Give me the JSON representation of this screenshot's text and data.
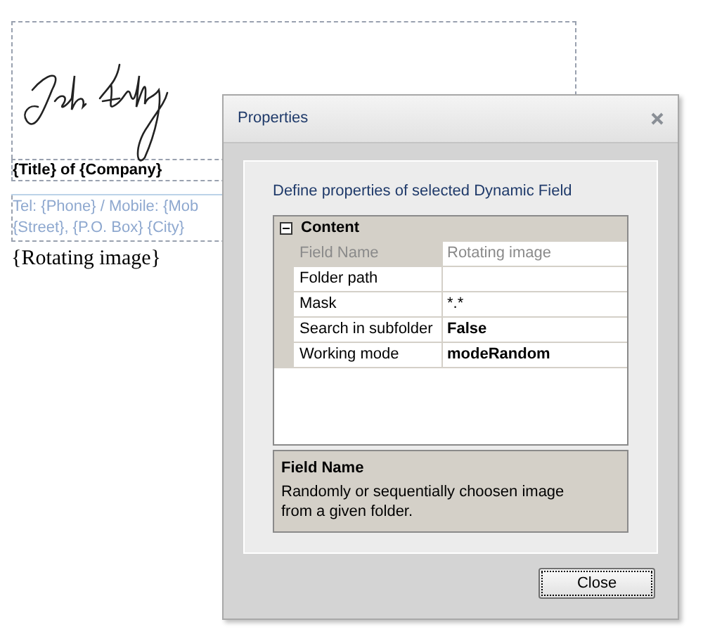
{
  "document": {
    "title_line": "{Title} of {Company}",
    "contact_lines": [
      "Tel: {Phone} / Mobile: {Mob",
      "{Street}, {P.O. Box} {City}"
    ],
    "rotating_image": "{Rotating image}"
  },
  "dialog": {
    "title": "Properties",
    "description": "Define properties of selected Dynamic Field",
    "category": {
      "name": "Content",
      "expanded": true
    },
    "properties": [
      {
        "name": "Field Name",
        "value": "Rotating image",
        "disabled": true,
        "modified": false
      },
      {
        "name": "Folder path",
        "disabled": false,
        "modified": false
      },
      {
        "name": "Mask",
        "value": "*.*",
        "disabled": false,
        "modified": false
      },
      {
        "name": "Search in subfolder",
        "value": "False",
        "disabled": false,
        "modified": true
      },
      {
        "name": "Working mode",
        "value": "modeRandom",
        "disabled": false,
        "modified": true
      }
    ],
    "help": {
      "title": "Field Name",
      "text": "Randomly or sequentially choosen image from a given folder."
    },
    "buttons": [
      "Close"
    ]
  }
}
